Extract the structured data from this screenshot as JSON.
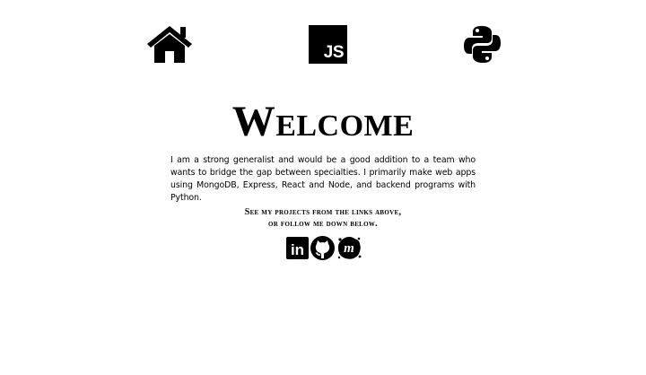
{
  "nav": {
    "items": [
      {
        "icon": "home-icon"
      },
      {
        "icon": "javascript-icon",
        "label": "JS"
      },
      {
        "icon": "python-icon"
      }
    ]
  },
  "main": {
    "heading": "Welcome",
    "intro": "I am a strong generalist and would be a good addition to a team who wants to bridge the gap between specialties. I primarily make web apps using MongoDB, Express, React and Node, and backend programs with Python.",
    "cta_line1": "See my projects from the links above,",
    "cta_line2": "or follow me down below."
  },
  "socials": [
    {
      "icon": "linkedin-icon",
      "label": "in"
    },
    {
      "icon": "github-icon"
    },
    {
      "icon": "meetup-icon",
      "label": "m"
    }
  ],
  "colors": {
    "background": "#ffffff",
    "foreground": "#000000"
  }
}
